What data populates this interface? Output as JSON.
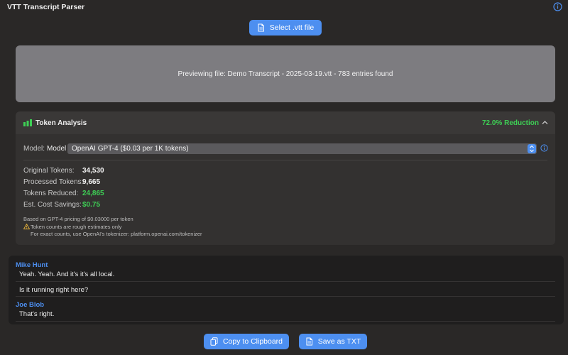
{
  "app": {
    "title": "VTT Transcript Parser"
  },
  "actions": {
    "select_label": "Select .vtt file",
    "copy_label": "Copy to Clipboard",
    "save_label": "Save as TXT"
  },
  "preview": {
    "message": "Previewing file: Demo Transcript - 2025-03-19.vtt - 783 entries found"
  },
  "token_analysis": {
    "title": "Token Analysis",
    "reduction": "72.0% Reduction",
    "model_label": "Model:",
    "model_label_inner": "Model",
    "model_value": "OpenAI GPT-4 ($0.03 per 1K tokens)",
    "stats": [
      {
        "label": "Original Tokens:",
        "value": "34,530"
      },
      {
        "label": "Processed Tokens:",
        "value": "9,665"
      },
      {
        "label": "Tokens Reduced:",
        "value": "24,865"
      },
      {
        "label": "Est. Cost Savings:",
        "value": "$0.75"
      }
    ],
    "pricing_note": "Based on GPT-4 pricing of $0.03000 per token",
    "warning_line1": "Token counts are rough estimates only",
    "warning_line2": "For exact counts, use OpenAI's tokenizer: platform.openai.com/tokenizer"
  },
  "transcript": [
    {
      "speaker": "Mike Hunt",
      "text": "Yeah. Yeah. And it's it's all local."
    },
    {
      "speaker": "",
      "text": "Is it running right here?"
    },
    {
      "speaker": "Joe Blob",
      "text": "That's right."
    }
  ],
  "colors": {
    "accent": "#4d8ff0",
    "success": "#3ecf55",
    "background": "#2a2827",
    "preview_bg": "#7d7c80"
  },
  "icons": [
    "info-icon",
    "document-icon",
    "bar-chart-icon",
    "chevron-up-icon",
    "select-arrows-icon",
    "warning-icon",
    "copy-icon"
  ]
}
